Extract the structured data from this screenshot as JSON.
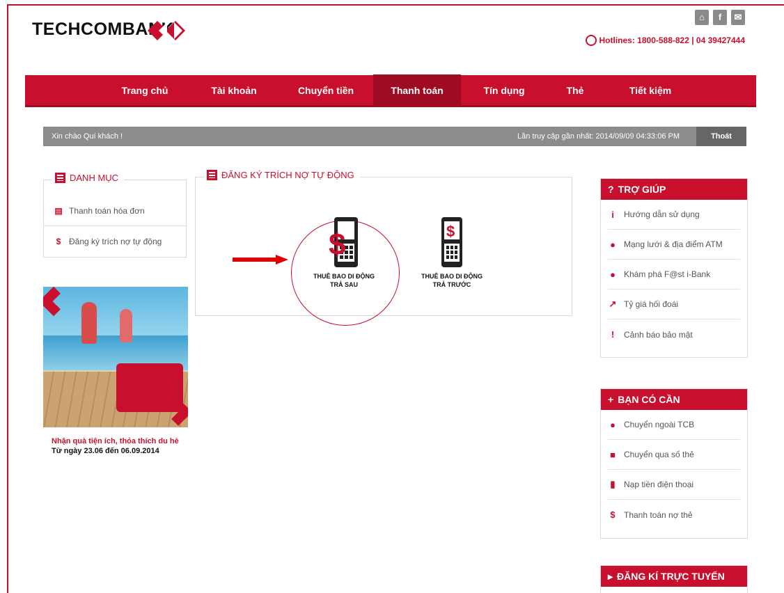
{
  "brand": {
    "name": "TECHCOMBANK"
  },
  "header": {
    "icons": [
      "home-icon",
      "facebook-icon",
      "mail-icon"
    ],
    "hotline": "Hotlines: 1800-588-822 | 04 39427444"
  },
  "nav": {
    "items": [
      {
        "label": "Trang chủ"
      },
      {
        "label": "Tài khoản"
      },
      {
        "label": "Chuyển tiền"
      },
      {
        "label": "Thanh toán",
        "active": true
      },
      {
        "label": "Tín dụng"
      },
      {
        "label": "Thẻ"
      },
      {
        "label": "Tiết kiệm"
      }
    ]
  },
  "greeting": {
    "welcome": "Xin chào Quí khách !",
    "last_access": "Lần truy cập gần nhất: 2014/09/09 04:33:06 PM",
    "logout": "Thoát"
  },
  "category": {
    "title": "DANH MỤC",
    "items": [
      {
        "label": "Thanh toán hóa đơn",
        "icon": "bill-icon"
      },
      {
        "label": "Đăng ký trích nợ tự động",
        "icon": "auto-debit-icon"
      }
    ]
  },
  "promo": {
    "caption1": "Nhận quà tiện ích, thỏa thích du hè",
    "caption2": "Từ ngày 23.06 đến 06.09.2014"
  },
  "main": {
    "title": "ĐĂNG KÝ TRÍCH NỢ TỰ ĐỘNG",
    "services": [
      {
        "line1": "THUÊ BAO DI ĐỘNG",
        "line2": "TRẢ SAU"
      },
      {
        "line1": "THUÊ BAO DI ĐỘNG",
        "line2": "TRẢ TRƯỚC"
      }
    ]
  },
  "help": {
    "title": "TRỢ GIÚP",
    "items": [
      {
        "label": "Hướng dẫn sử dụng",
        "glyph": "i"
      },
      {
        "label": "Mạng lưới & địa điểm ATM",
        "glyph": "●"
      },
      {
        "label": "Khám phá F@st i-Bank",
        "glyph": "●"
      },
      {
        "label": "Tỷ giá hối đoái",
        "glyph": "↗"
      },
      {
        "label": "Cảnh báo bảo mật",
        "glyph": "!"
      }
    ]
  },
  "need": {
    "title": "BẠN CÓ CẦN",
    "items": [
      {
        "label": "Chuyển ngoài TCB",
        "glyph": "●"
      },
      {
        "label": "Chuyển qua số thẻ",
        "glyph": "■"
      },
      {
        "label": "Nạp tiền điện thoại",
        "glyph": "▮"
      },
      {
        "label": "Thanh toán nợ thẻ",
        "glyph": "$"
      }
    ]
  },
  "register": {
    "title": "ĐĂNG KÍ TRỰC TUYẾN"
  }
}
